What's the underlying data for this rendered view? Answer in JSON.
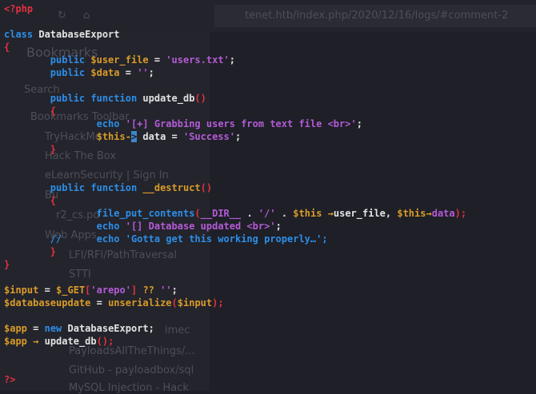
{
  "background": {
    "url": "tenet.htb/index.php/2020/12/16/logs/#comment-2",
    "sidebar_title": "Bookmarks",
    "search": "Search",
    "items": [
      "Bookmarks Toolbar",
      "TryHackMe",
      "Hack The Box",
      "eLearnSecurity | Sign In",
      "Bu",
      "r2_cs.pd",
      "Web Apps",
      "LFI/RFI/PathTraversal",
      "STTI",
      "imec",
      "PayloadsAllTheThings/...",
      "GitHub - payloadbox/sql",
      "MySQL Injection - Hack"
    ]
  },
  "colors": {
    "text": "#e3e3e3",
    "keyword": "#2d8ee8",
    "variable": "#d99b28",
    "string": "#b45bd6",
    "brace": "#e0323f",
    "function": "#2d8ee8",
    "comment": "#2d8ee8",
    "operator": "#d99b28",
    "cursor": "#3d87c8"
  },
  "code_lines": [
    [
      {
        "t": "<?php",
        "c": "brace"
      }
    ],
    [],
    [
      {
        "t": "class ",
        "c": "keyword"
      },
      {
        "t": "DatabaseExport",
        "c": "text"
      }
    ],
    [
      {
        "t": "{",
        "c": "brace"
      }
    ],
    [
      {
        "t": "        public ",
        "c": "keyword"
      },
      {
        "t": "$user_file",
        "c": "variable"
      },
      {
        "t": " = ",
        "c": "text"
      },
      {
        "t": "'users.txt'",
        "c": "string"
      },
      {
        "t": ";",
        "c": "text"
      }
    ],
    [
      {
        "t": "        public ",
        "c": "keyword"
      },
      {
        "t": "$data",
        "c": "variable"
      },
      {
        "t": " = ",
        "c": "text"
      },
      {
        "t": "''",
        "c": "string"
      },
      {
        "t": ";",
        "c": "text"
      }
    ],
    [],
    [
      {
        "t": "        public function ",
        "c": "keyword"
      },
      {
        "t": "update_db",
        "c": "text"
      },
      {
        "t": "()",
        "c": "brace"
      }
    ],
    [
      {
        "t": "        {",
        "c": "brace"
      }
    ],
    [
      {
        "t": "                echo ",
        "c": "keyword"
      },
      {
        "t": "'[+] Grabbing users from text file <br>'",
        "c": "string"
      },
      {
        "t": ";",
        "c": "text"
      }
    ],
    [
      {
        "t": "                $this",
        "c": "variable"
      },
      {
        "t": "-",
        "c": "operator"
      },
      {
        "t": ">",
        "c": "cursor"
      },
      {
        "t": " data = ",
        "c": "text"
      },
      {
        "t": "'Success'",
        "c": "string"
      },
      {
        "t": ";",
        "c": "text"
      }
    ],
    [
      {
        "t": "        }",
        "c": "brace"
      }
    ],
    [],
    [],
    [
      {
        "t": "        public function ",
        "c": "keyword"
      },
      {
        "t": "__destruct",
        "c": "variable"
      },
      {
        "t": "()",
        "c": "brace"
      }
    ],
    [
      {
        "t": "        {",
        "c": "brace"
      }
    ],
    [
      {
        "t": "                file_put_contents",
        "c": "keyword"
      },
      {
        "t": "(",
        "c": "brace"
      },
      {
        "t": "__DIR__",
        "c": "string"
      },
      {
        "t": " . ",
        "c": "text"
      },
      {
        "t": "'/'",
        "c": "string"
      },
      {
        "t": " . ",
        "c": "text"
      },
      {
        "t": "$this",
        "c": "variable"
      },
      {
        "t": " →",
        "c": "operator"
      },
      {
        "t": "user_file, ",
        "c": "text"
      },
      {
        "t": "$this",
        "c": "variable"
      },
      {
        "t": "→",
        "c": "operator"
      },
      {
        "t": "data",
        "c": "string"
      },
      {
        "t": ");",
        "c": "brace"
      }
    ],
    [
      {
        "t": "                echo ",
        "c": "keyword"
      },
      {
        "t": "'[] Database updated <br>'",
        "c": "string"
      },
      {
        "t": ";",
        "c": "text"
      }
    ],
    [
      {
        "t": "        //      echo 'Gotta get this working properly…';",
        "c": "keyword"
      }
    ],
    [
      {
        "t": "        }",
        "c": "brace"
      }
    ],
    [
      {
        "t": "}",
        "c": "brace"
      }
    ],
    [],
    [
      {
        "t": "$input",
        "c": "variable"
      },
      {
        "t": " = ",
        "c": "text"
      },
      {
        "t": "$_GET",
        "c": "variable"
      },
      {
        "t": "[",
        "c": "brace"
      },
      {
        "t": "'arepo'",
        "c": "string"
      },
      {
        "t": "]",
        "c": "brace"
      },
      {
        "t": " ?? ",
        "c": "variable"
      },
      {
        "t": "''",
        "c": "string"
      },
      {
        "t": ";",
        "c": "text"
      }
    ],
    [
      {
        "t": "$databaseupdate",
        "c": "variable"
      },
      {
        "t": " = ",
        "c": "text"
      },
      {
        "t": "unserialize",
        "c": "variable"
      },
      {
        "t": "(",
        "c": "brace"
      },
      {
        "t": "$input",
        "c": "variable"
      },
      {
        "t": ");",
        "c": "brace"
      }
    ],
    [],
    [
      {
        "t": "$app",
        "c": "variable"
      },
      {
        "t": " = ",
        "c": "text"
      },
      {
        "t": "new ",
        "c": "keyword"
      },
      {
        "t": "DatabaseExport",
        "c": "text"
      },
      {
        "t": ";",
        "c": "text"
      }
    ],
    [
      {
        "t": "$app",
        "c": "variable"
      },
      {
        "t": " → ",
        "c": "operator"
      },
      {
        "t": "update_db",
        "c": "text"
      },
      {
        "t": "();",
        "c": "brace"
      }
    ],
    [],
    [],
    [
      {
        "t": "?>",
        "c": "brace"
      }
    ]
  ]
}
